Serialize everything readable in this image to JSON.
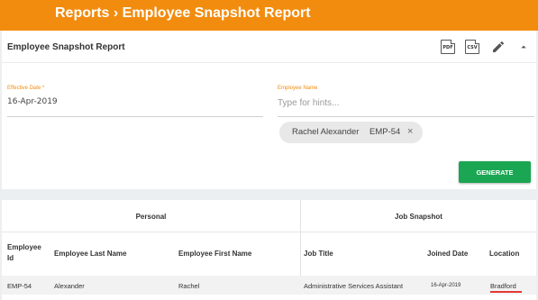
{
  "header": {
    "title": "Reports › Employee Snapshot Report"
  },
  "card": {
    "title": "Employee Snapshot Report",
    "icons": [
      {
        "name": "pdf-icon",
        "label": "PDF"
      },
      {
        "name": "csv-icon",
        "label": "CSV"
      },
      {
        "name": "pencil-icon"
      },
      {
        "name": "chevron-up-icon"
      }
    ]
  },
  "form": {
    "effective_date": {
      "label": "Effective Date *",
      "value": "16-Apr-2019"
    },
    "employee_name": {
      "label": "Employee Name",
      "placeholder": "Type for hints..."
    },
    "chip": {
      "name": "Rachel Alexander",
      "id": "EMP-54",
      "close": "×"
    },
    "generate_label": "GENERATE"
  },
  "table": {
    "groups": {
      "personal": "Personal",
      "job_snapshot": "Job Snapshot"
    },
    "columns": {
      "employee_id": "Employee Id",
      "last_name": "Employee Last Name",
      "first_name": "Employee First Name",
      "job_title": "Job Title",
      "joined_date": "Joined Date",
      "location": "Location"
    },
    "rows": [
      {
        "employee_id": "EMP-54",
        "last_name": "Alexander",
        "first_name": "Rachel",
        "job_title": "Administrative Services Assistant",
        "joined_date": "16-Apr-2019",
        "location": "Bradford"
      }
    ]
  },
  "colors": {
    "brand": "#f28c0f",
    "generate": "#1aa652",
    "highlight": "#e53935"
  }
}
